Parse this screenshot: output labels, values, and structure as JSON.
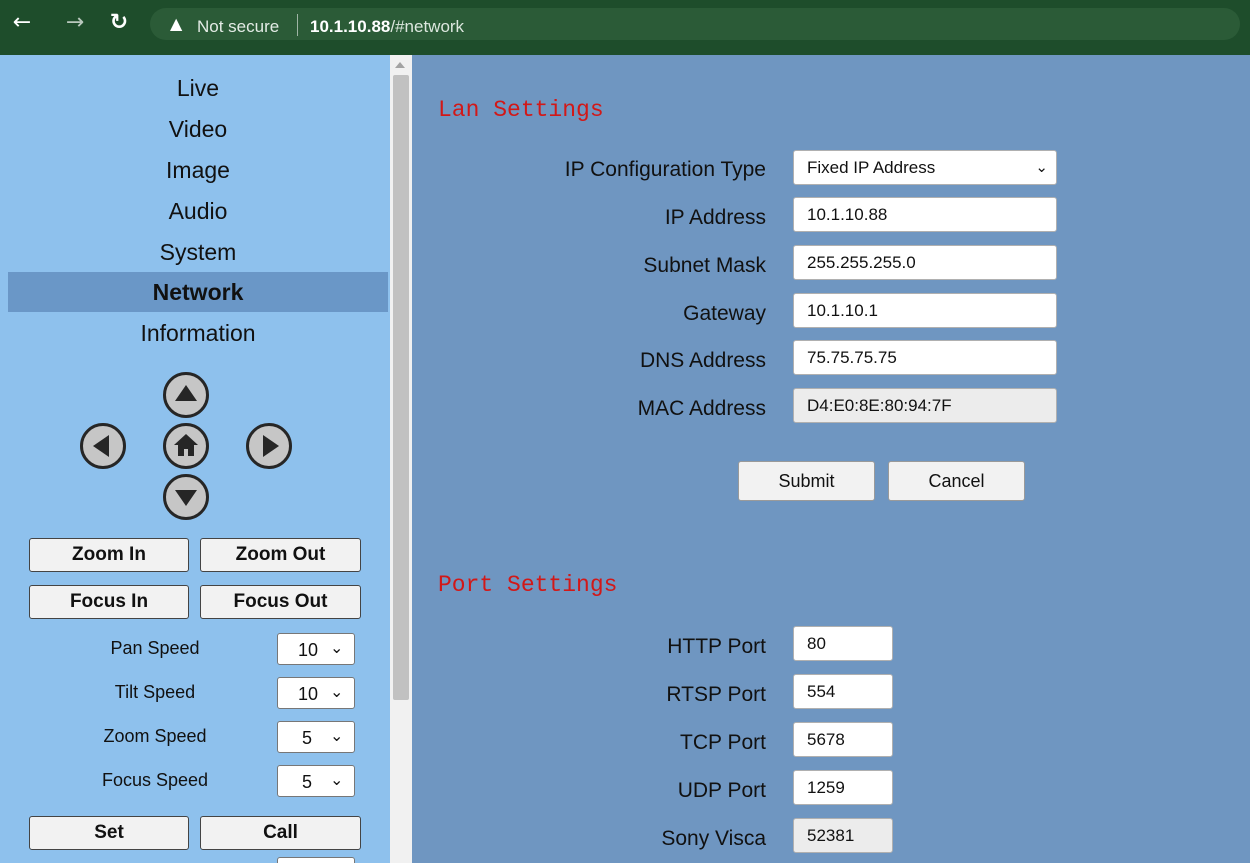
{
  "browser": {
    "back_icon": "arrow-left-icon",
    "forward_icon": "arrow-right-icon",
    "reload_icon": "reload-icon",
    "security_status": "Not secure",
    "url_host": "10.1.10.88",
    "url_path": "/#network"
  },
  "sidebar": {
    "menu": [
      "Live",
      "Video",
      "Image",
      "Audio",
      "System",
      "Network",
      "Information"
    ],
    "active": "Network",
    "ptz_icons": [
      "up-arrow-icon",
      "left-arrow-icon",
      "home-icon",
      "right-arrow-icon",
      "down-arrow-icon"
    ],
    "zoom_in": "Zoom In",
    "zoom_out": "Zoom Out",
    "focus_in": "Focus In",
    "focus_out": "Focus Out",
    "speeds": [
      {
        "label": "Pan Speed",
        "value": "10"
      },
      {
        "label": "Tilt Speed",
        "value": "10"
      },
      {
        "label": "Zoom Speed",
        "value": "5"
      },
      {
        "label": "Focus Speed",
        "value": "5"
      }
    ],
    "set": "Set",
    "call": "Call"
  },
  "lan": {
    "title": "Lan Settings",
    "ip_config_type": {
      "label": "IP Configuration Type",
      "value": "Fixed IP Address"
    },
    "ip_address": {
      "label": "IP Address",
      "value": "10.1.10.88"
    },
    "subnet_mask": {
      "label": "Subnet Mask",
      "value": "255.255.255.0"
    },
    "gateway": {
      "label": "Gateway",
      "value": "10.1.10.1"
    },
    "dns": {
      "label": "DNS Address",
      "value": "75.75.75.75"
    },
    "mac": {
      "label": "MAC Address",
      "value": "D4:E0:8E:80:94:7F"
    },
    "submit": "Submit",
    "cancel": "Cancel"
  },
  "ports": {
    "title": "Port Settings",
    "http": {
      "label": "HTTP Port",
      "value": "80"
    },
    "rtsp": {
      "label": "RTSP Port",
      "value": "554"
    },
    "tcp": {
      "label": "TCP Port",
      "value": "5678"
    },
    "udp": {
      "label": "UDP Port",
      "value": "1259"
    },
    "visca": {
      "label": "Sony Visca",
      "value": "52381"
    }
  },
  "colors": {
    "page_bg": "#6f96c1",
    "sidebar_bg": "#8ec1ed",
    "active_menu": "#6a97c7",
    "section_title": "#d21818",
    "browser_bar": "#1e4d2b"
  }
}
